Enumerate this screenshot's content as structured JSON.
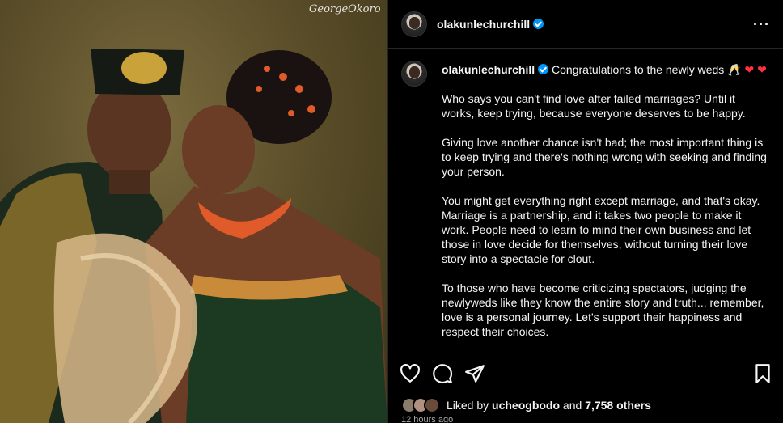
{
  "photo": {
    "watermark": "GeorgeOkoro",
    "alt_subject": "couple in traditional attire"
  },
  "post": {
    "username": "olakunlechurchill",
    "verified": true,
    "caption_opening": "Congratulations to the newly weds 🥂",
    "heart_glyph": "❤",
    "paragraphs": [
      "Who says you can't find love after failed marriages? Until it works, keep trying, because everyone deserves to be happy.",
      "Giving love another chance isn't bad; the most important thing is to keep trying and there's nothing wrong with seeking and finding your person.",
      "You might get everything right except marriage, and that's okay. Marriage is a partnership, and it takes two people to make it work. People need to learn to mind their own business and let those in love decide for themselves, without turning their love story into a spectacle for clout.",
      "To those who have become criticizing spectators, judging the newlyweds like they know the entire story and truth... remember, love is a personal journey. Let's support their happiness and respect their choices."
    ],
    "likes_prefix": "Liked by ",
    "liked_by_user": "ucheogbodo",
    "likes_and": " and ",
    "likes_count": "7,758 others",
    "timestamp": "12 hours ago"
  },
  "icons": {
    "more": "more-options-icon",
    "like": "heart-icon",
    "comment": "comment-icon",
    "share": "share-icon",
    "save": "bookmark-icon"
  },
  "colors": {
    "background": "#000000",
    "verified": "#0095f6",
    "heart": "#ff3040",
    "muted": "#a8a8a8"
  }
}
